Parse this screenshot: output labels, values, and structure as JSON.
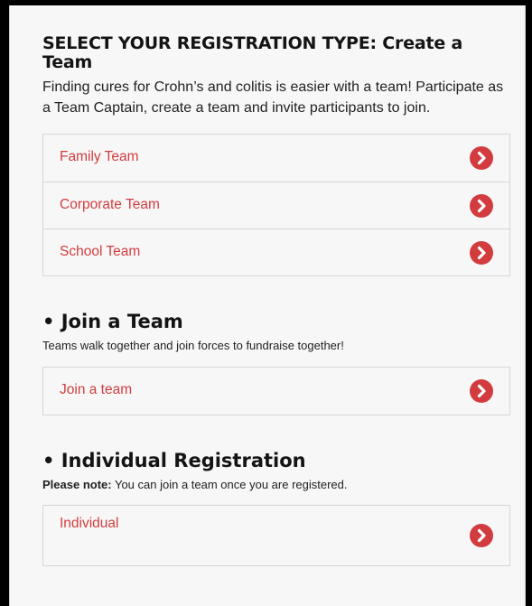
{
  "create_team": {
    "title": "SELECT YOUR REGISTRATION TYPE: Create a Team",
    "description": "Finding cures for Crohn’s and colitis is easier with a team! Participate as a Team Captain, create a team and invite participants to join.",
    "options": [
      {
        "label": "Family Team"
      },
      {
        "label": "Corporate Team"
      },
      {
        "label": "School Team"
      }
    ]
  },
  "join_team": {
    "title": "• Join a Team",
    "description": "Teams walk together and join forces to fundraise together!",
    "options": [
      {
        "label": "Join a team"
      }
    ]
  },
  "individual": {
    "title": "• Individual Registration",
    "note_label": "Please note:",
    "note_text": " You can join a team once you are registered.",
    "options": [
      {
        "label": "Individual"
      }
    ]
  },
  "colors": {
    "accent": "#d23c3f",
    "background": "#f7f7f7",
    "frame": "#000000"
  },
  "icons": {
    "option_arrow": "chevron-right-circle-icon"
  }
}
